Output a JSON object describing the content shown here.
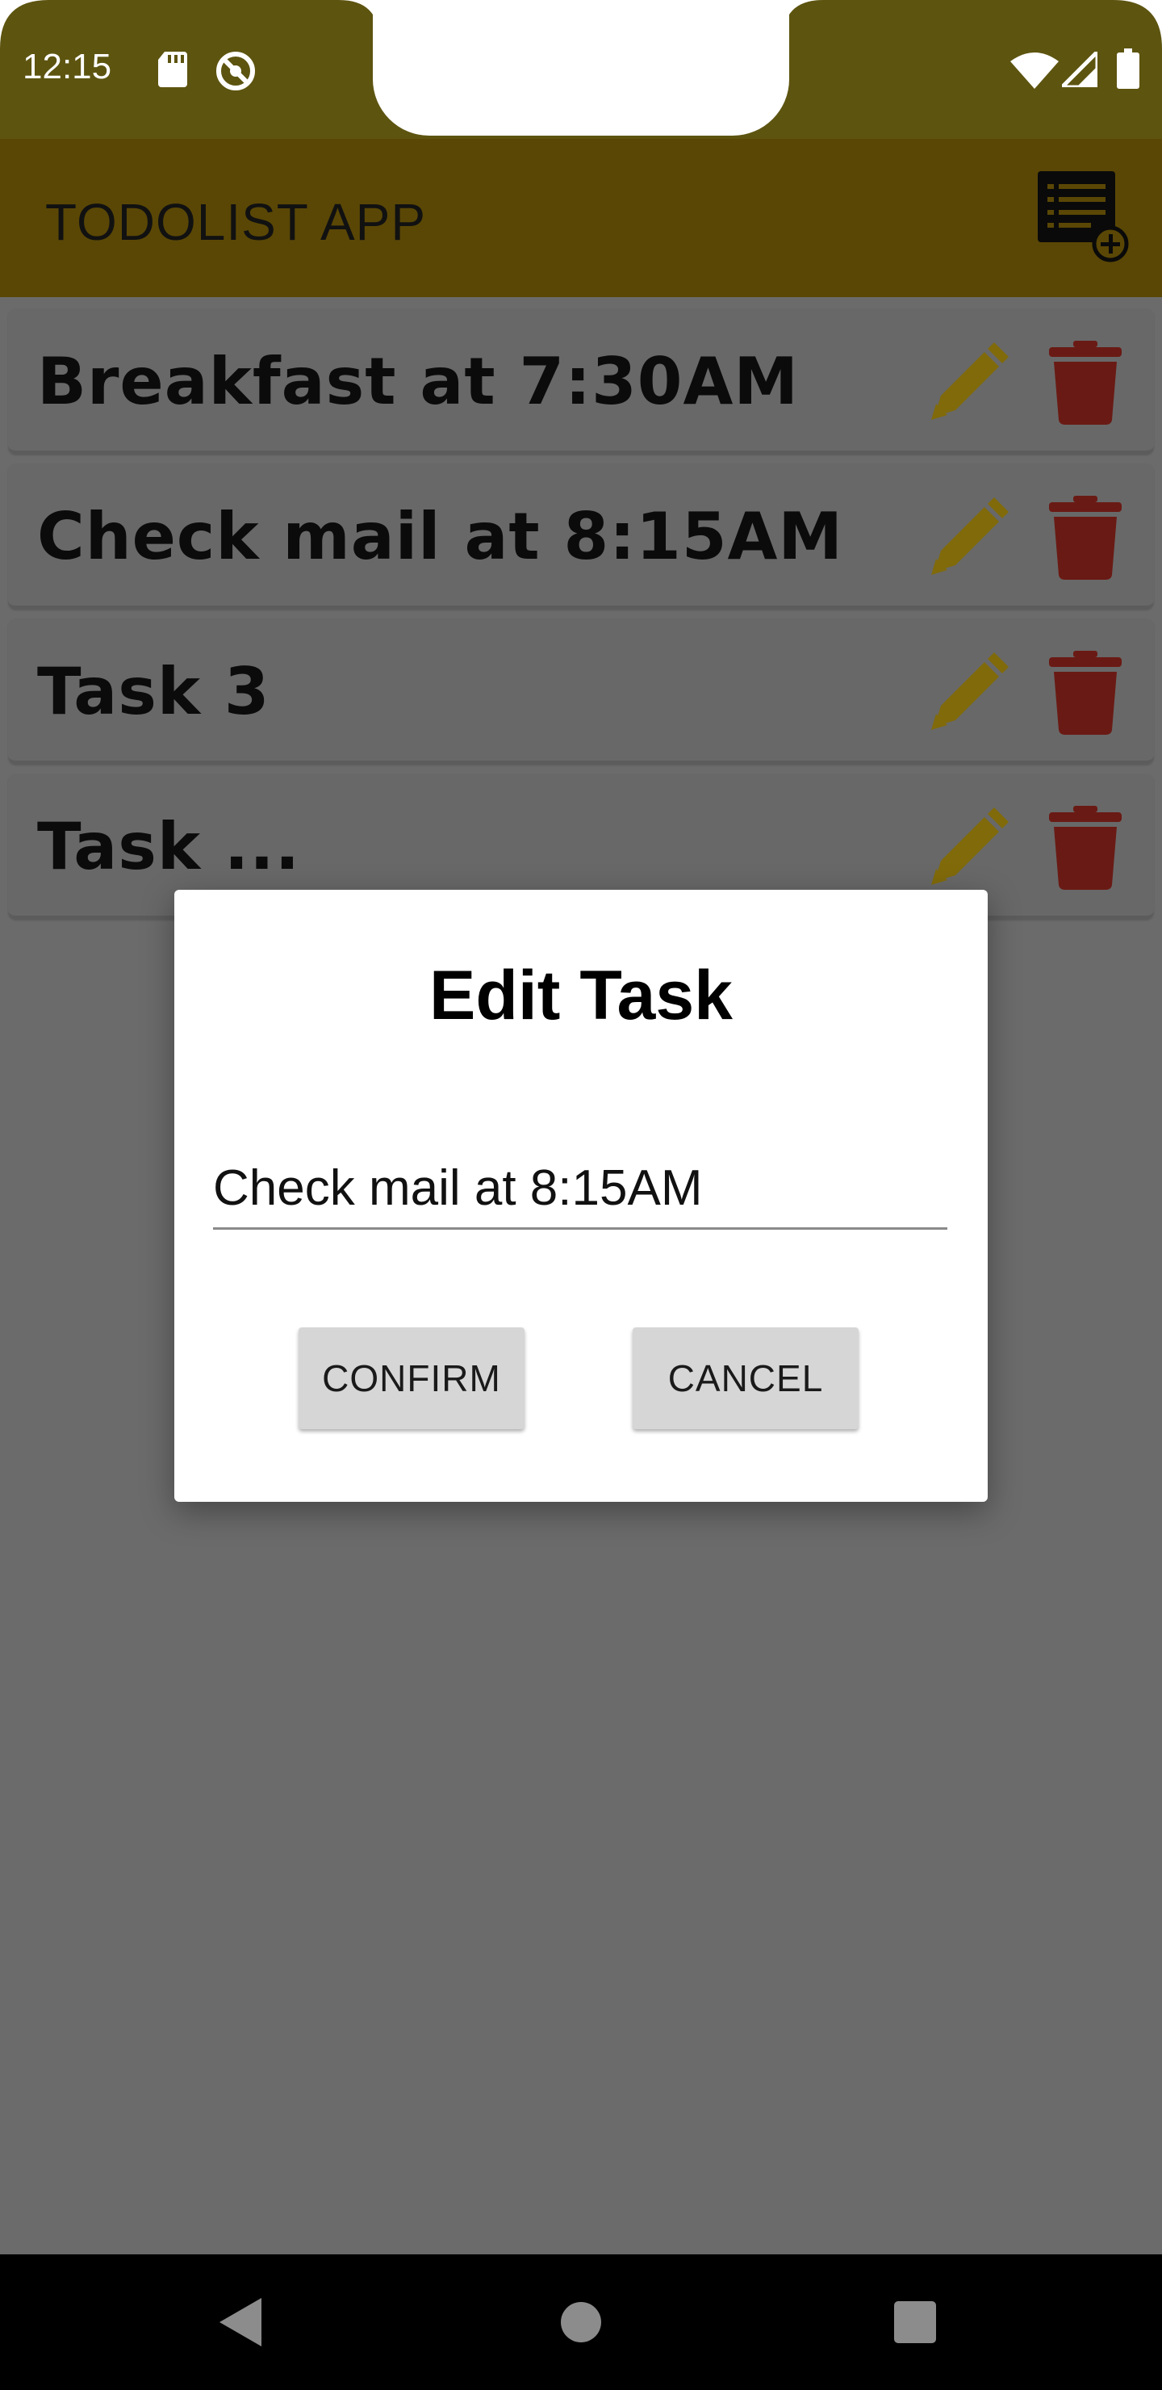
{
  "status_bar": {
    "time": "12:15",
    "icons": [
      "sd-card-icon",
      "sync-icon",
      "wifi-icon",
      "signal-icon",
      "battery-icon"
    ]
  },
  "app_bar": {
    "title": "TODOLIST APP",
    "add_icon": "add-list-icon"
  },
  "tasks": [
    {
      "label": "Breakfast at 7:30AM"
    },
    {
      "label": "Check mail at 8:15AM"
    },
    {
      "label": "Task 3"
    },
    {
      "label": "Task ..."
    }
  ],
  "dialog": {
    "title": "Edit Task",
    "input_value": "Check mail at 8:15AM",
    "confirm_label": "CONFIRM",
    "cancel_label": "CANCEL"
  },
  "colors": {
    "status_bar": "#5d5410",
    "app_bar": "#5a4705",
    "edit_icon": "#806a0a",
    "delete_icon": "#6a1a14",
    "scrim": "#6b6b6b"
  }
}
